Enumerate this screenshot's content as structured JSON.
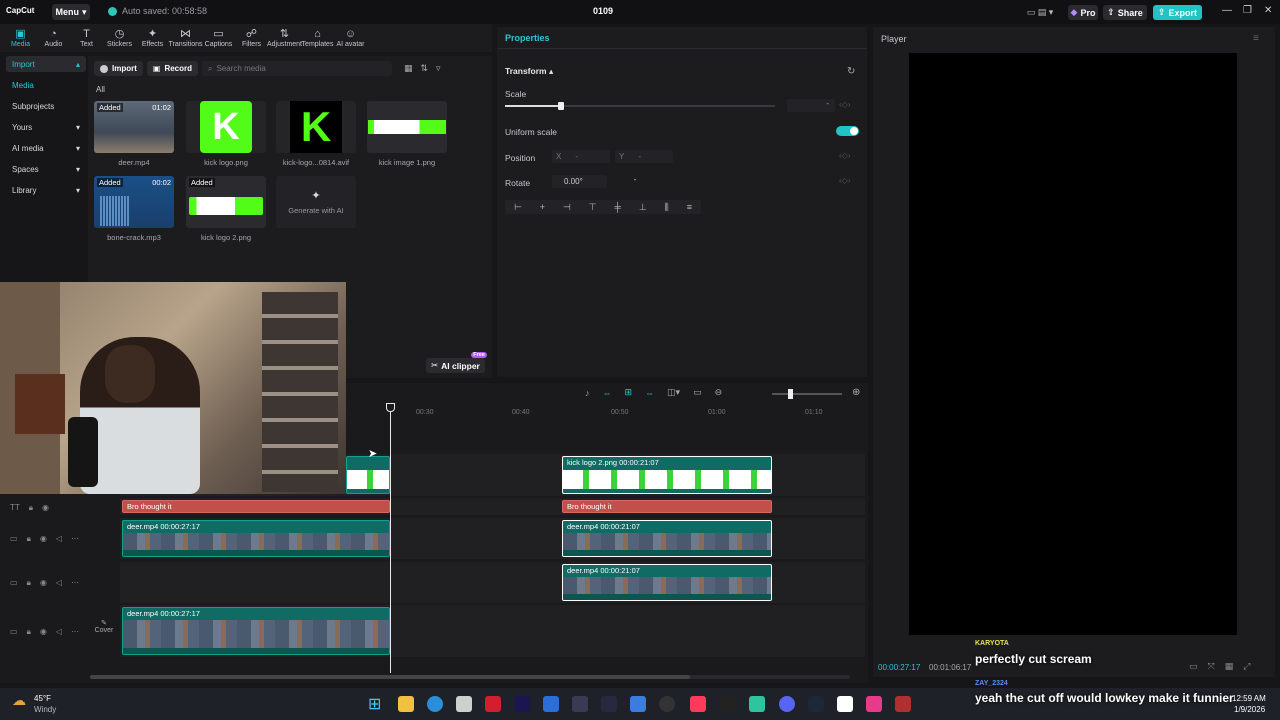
{
  "titlebar": {
    "logo": "CapCut",
    "menu": "Menu",
    "autosave": "Auto saved: 00:58:58",
    "project": "0109",
    "pro": "Pro",
    "share": "Share",
    "export": "Export"
  },
  "toolbar": [
    {
      "label": "Media",
      "icon": "▣"
    },
    {
      "label": "Audio",
      "icon": "◔"
    },
    {
      "label": "Text",
      "icon": "T"
    },
    {
      "label": "Stickers",
      "icon": "◷"
    },
    {
      "label": "Effects",
      "icon": "✦"
    },
    {
      "label": "Transitions",
      "icon": "⋈"
    },
    {
      "label": "Captions",
      "icon": "▭"
    },
    {
      "label": "Filters",
      "icon": "☍"
    },
    {
      "label": "Adjustment",
      "icon": "⇅"
    },
    {
      "label": "Templates",
      "icon": "⌂"
    },
    {
      "label": "AI avatar",
      "icon": "☺"
    }
  ],
  "leftnav": [
    {
      "label": "Import"
    },
    {
      "label": "Media"
    },
    {
      "label": "Subprojects"
    },
    {
      "label": "Yours"
    },
    {
      "label": "AI media"
    },
    {
      "label": "Spaces"
    },
    {
      "label": "Library"
    }
  ],
  "media": {
    "import": "Import",
    "record": "Record",
    "search_placeholder": "Search media",
    "all": "All",
    "items": [
      {
        "name": "deer.mp4",
        "tag": "Added",
        "dur": "01:02"
      },
      {
        "name": "kick logo.png",
        "tag": "",
        "dur": ""
      },
      {
        "name": "kick-logo...0814.avif",
        "tag": "",
        "dur": ""
      },
      {
        "name": "kick image 1.png",
        "tag": "",
        "dur": ""
      },
      {
        "name": "bone-crack.mp3",
        "tag": "Added",
        "dur": "00:02"
      },
      {
        "name": "kick logo 2.png",
        "tag": "Added",
        "dur": ""
      }
    ],
    "generate": "Generate with AI",
    "ai_clipper": "AI clipper",
    "free": "Free"
  },
  "props": {
    "title": "Properties",
    "transform": "Transform",
    "scale": "Scale",
    "scale_value": "-",
    "uniform": "Uniform scale",
    "position": "Position",
    "x_label": "X",
    "x_value": "-",
    "y_label": "Y",
    "y_value": "-",
    "rotate": "Rotate",
    "rotate_value": "0.00°",
    "rotate_dash": "-"
  },
  "player": {
    "title": "Player",
    "time_current": "00:00:27:17",
    "time_total": "00:01:06:17"
  },
  "timeline": {
    "ruler": [
      "00:30",
      "00:40",
      "00:50",
      "01:00",
      "01:10"
    ],
    "clips": {
      "img1": "kick logo 2.png  00:00:21:07",
      "text1": "Bro thought it",
      "text2": "Bro thought it",
      "v1a": "deer.mp4  00:00:27:17",
      "v1b": "deer.mp4  00:00:21:07",
      "v2b": "deer.mp4  00:00:21:07",
      "v3a": "deer.mp4  00:00:27:17"
    },
    "cover": "Cover"
  },
  "chat": [
    {
      "user": "KARYOTA",
      "message": "perfectly cut scream"
    },
    {
      "user": "ZAY_2324",
      "message": "yeah the cut off would lowkey make it funnier"
    }
  ],
  "taskbar": {
    "weather_temp": "45°F",
    "weather_desc": "Windy",
    "time": "12:59 AM",
    "date": "1/9/2026"
  }
}
